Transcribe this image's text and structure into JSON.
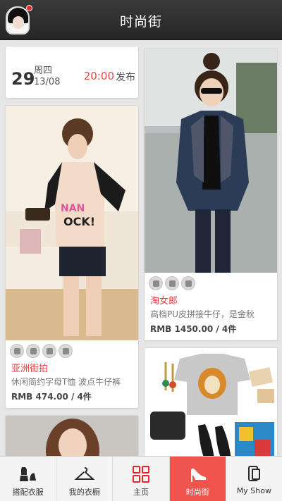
{
  "header": {
    "title": "时尚街"
  },
  "date_card": {
    "day": "29",
    "weekday": "周四",
    "month_day": "13/08",
    "time": "20:00",
    "publish": "发布"
  },
  "left_items": [
    {
      "shop": "亚洲街拍",
      "desc": "休闲简约字母T恤 波点牛仔裤",
      "price": "RMB 474.00 / 4件"
    }
  ],
  "right_items": [
    {
      "shop": "淘女郎",
      "desc": "高档PU皮拼接牛仔，是金秋",
      "price": "RMB 1450.00 / 4件"
    }
  ],
  "nav": [
    {
      "label": "搭配衣服",
      "icon": "outfit-icon",
      "active": false
    },
    {
      "label": "我的衣橱",
      "icon": "hanger-icon",
      "active": false
    },
    {
      "label": "主页",
      "icon": "grid-icon",
      "active": false
    },
    {
      "label": "时尚街",
      "icon": "high-heel-icon",
      "active": true
    },
    {
      "label": "My Show",
      "icon": "phone-icon",
      "active": false
    }
  ],
  "colors": {
    "accent": "#f0544e",
    "shop_name": "#e83c3c",
    "header": "#2b2b2b"
  }
}
